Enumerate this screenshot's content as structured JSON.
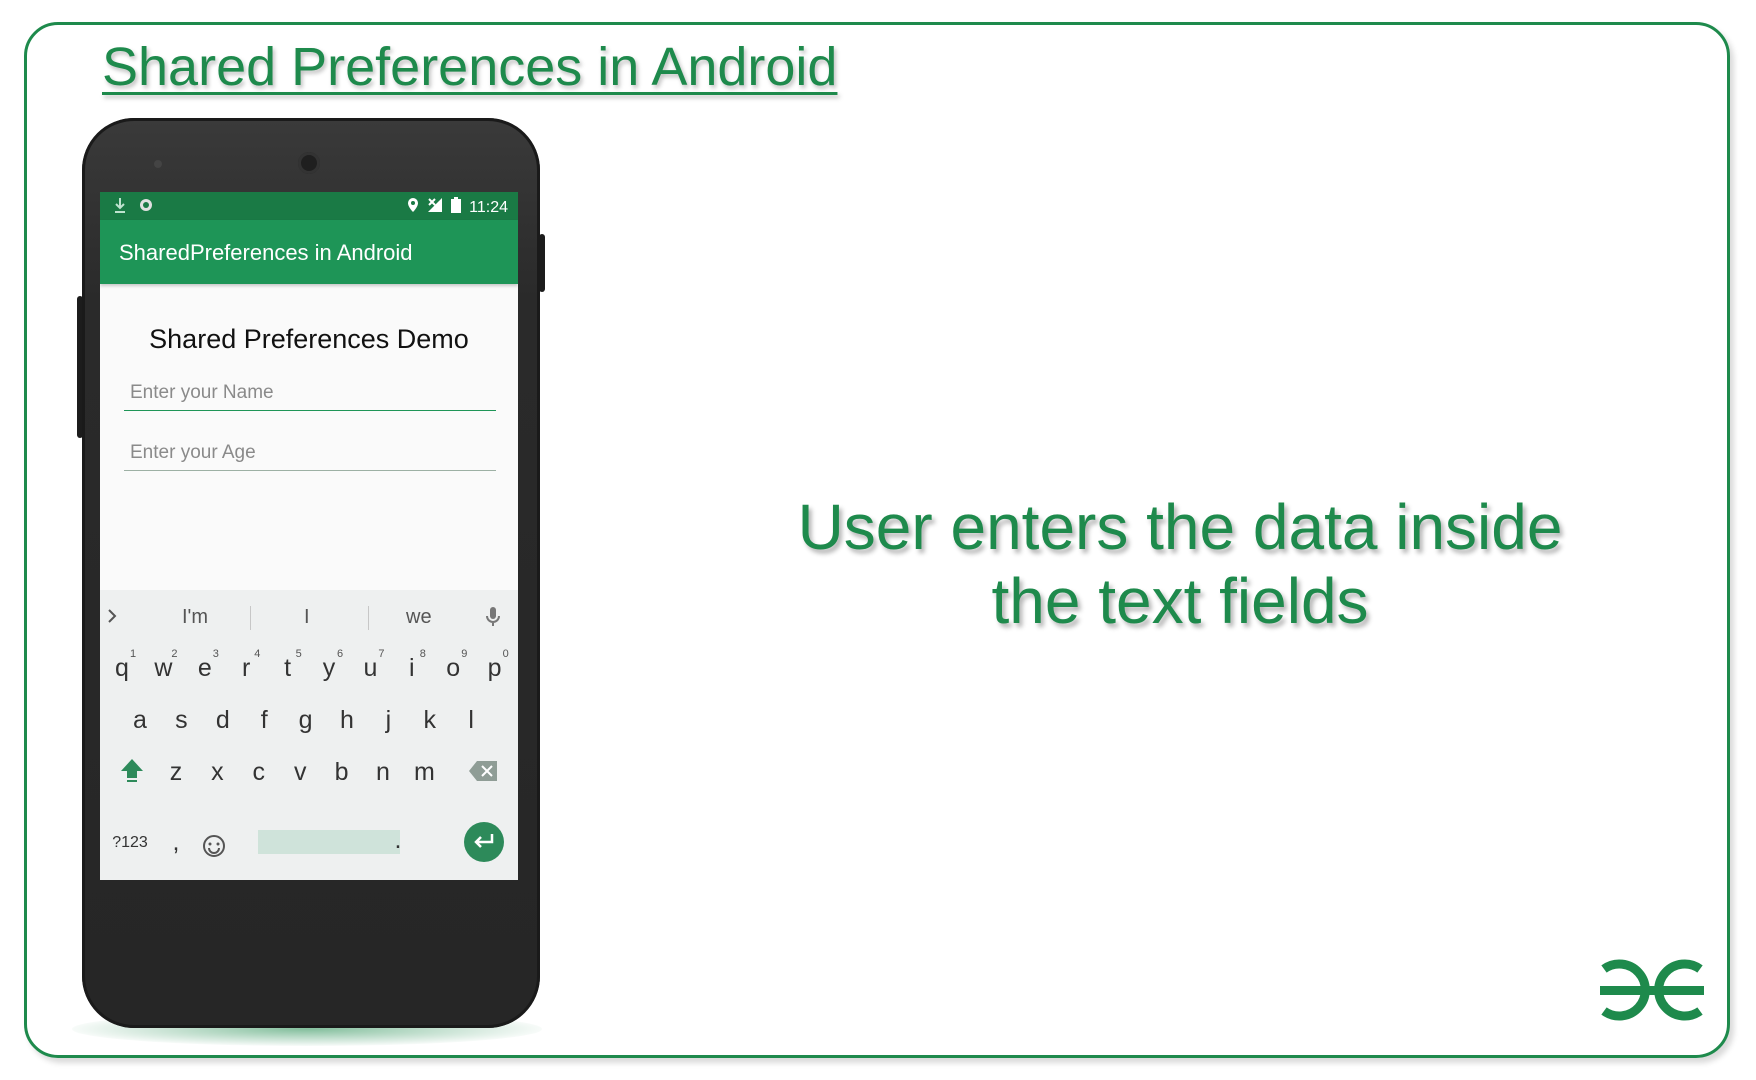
{
  "slide": {
    "title": "Shared Preferences in Android",
    "caption_line1": "User enters the data inside",
    "caption_line2": "the text fields",
    "logo_icon": "gfg-logo",
    "accent_color": "#1e8a4c"
  },
  "phone": {
    "status_time": "11:24",
    "app_title": "SharedPreferences in Android",
    "screen_title": "Shared Preferences Demo",
    "name_placeholder": "Enter your Name",
    "age_placeholder": "Enter your Age",
    "suggestions": [
      "I'm",
      "I",
      "we"
    ],
    "row1": [
      "q",
      "w",
      "e",
      "r",
      "t",
      "y",
      "u",
      "i",
      "o",
      "p"
    ],
    "row1_hints": [
      "1",
      "2",
      "3",
      "4",
      "5",
      "6",
      "7",
      "8",
      "9",
      "0"
    ],
    "row2": [
      "a",
      "s",
      "d",
      "f",
      "g",
      "h",
      "j",
      "k",
      "l"
    ],
    "row3": [
      "z",
      "x",
      "c",
      "v",
      "b",
      "n",
      "m"
    ],
    "symbols_key": "?123",
    "comma_key": ",",
    "period_key": ".",
    "app_bar_color": "#1e9557",
    "status_bar_color": "#1a7a45"
  }
}
